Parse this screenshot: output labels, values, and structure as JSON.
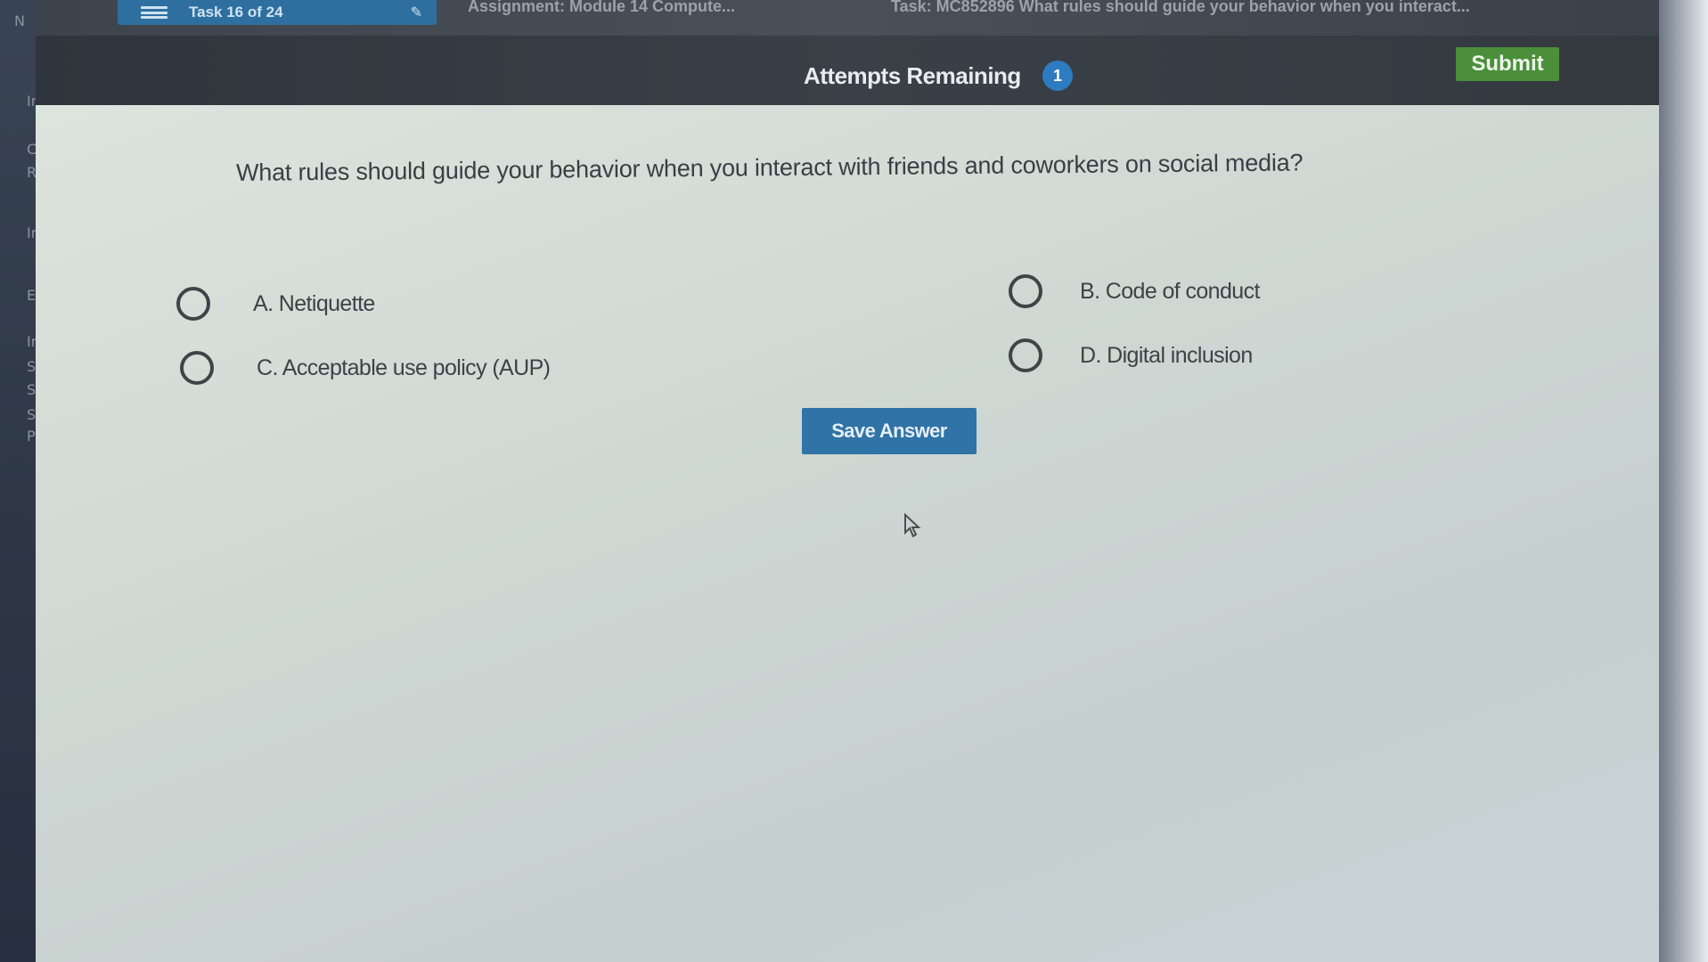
{
  "top_tab": {
    "label": "Task 16 of 24",
    "assignment_text": "Assignment: Module 14 Compute...",
    "task_text": "Task: MC852896 What rules should guide your behavior when you interact..."
  },
  "toolbar": {
    "attempts_label": "Attempts Remaining",
    "attempts_count": "1",
    "submit_label": "Submit"
  },
  "question": {
    "text": "What rules should guide your behavior when you interact with friends and coworkers on social media?"
  },
  "options": [
    {
      "label": "A. Netiquette"
    },
    {
      "label": "B. Code of conduct"
    },
    {
      "label": "C. Acceptable use policy (AUP)"
    },
    {
      "label": "D. Digital inclusion"
    }
  ],
  "save_button": {
    "label": "Save Answer"
  },
  "left_gutter_letters": [
    "N",
    "Ir",
    "C",
    "R",
    "Ir",
    "E",
    "Ir",
    "S",
    "S",
    "S",
    "P"
  ],
  "colors": {
    "toolbar_bg": "#363c42",
    "submit_green": "#4b8f3b",
    "save_blue": "#2f73a7",
    "badge_blue": "#2d7bc1",
    "content_bg": "#d3dbd6"
  }
}
